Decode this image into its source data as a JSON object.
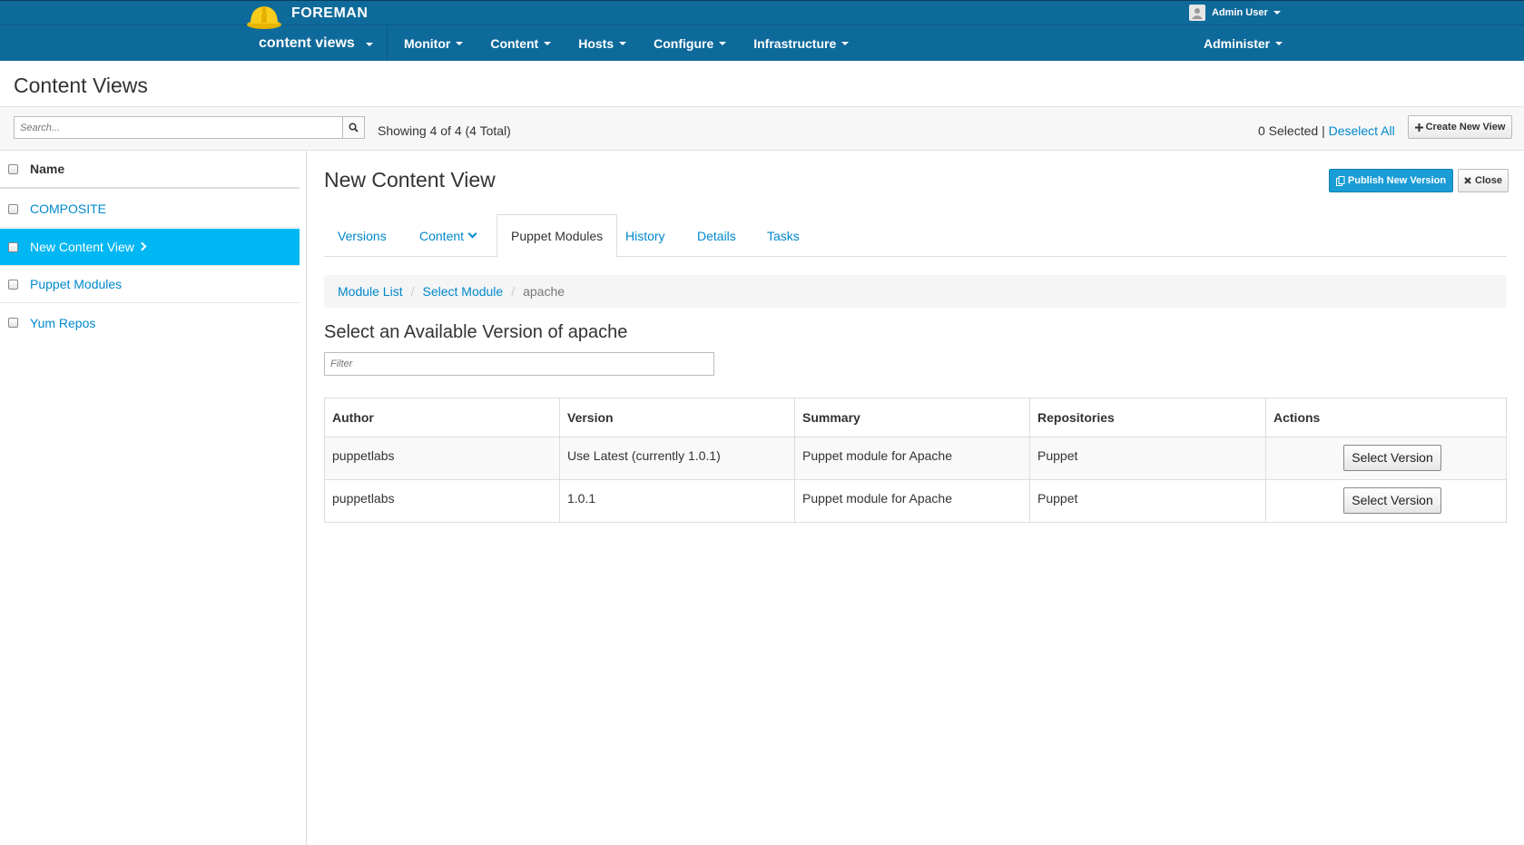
{
  "app": {
    "brand": "FOREMAN",
    "user": "Admin User",
    "context": "content views",
    "nav": [
      "Monitor",
      "Content",
      "Hosts",
      "Configure",
      "Infrastructure"
    ],
    "admin": "Administer"
  },
  "page": {
    "title": "Content Views",
    "search_placeholder": "Search...",
    "showing": "Showing 4 of 4 (4 Total)",
    "selected": "0 Selected",
    "separator": "|",
    "deselect": "Deselect All",
    "create": "Create New View"
  },
  "list": {
    "header": "Name",
    "items": [
      "COMPOSITE",
      "New Content View",
      "Puppet Modules",
      "Yum Repos"
    ]
  },
  "detail": {
    "title": "New Content View",
    "publish": "Publish New Version",
    "close": "Close",
    "tabs": [
      "Versions",
      "Content",
      "Puppet Modules",
      "History",
      "Details",
      "Tasks"
    ],
    "breadcrumb": [
      "Module List",
      "Select Module",
      "apache"
    ],
    "section_title": "Select an Available Version of apache",
    "filter_placeholder": "Filter"
  },
  "table": {
    "headers": [
      "Author",
      "Version",
      "Summary",
      "Repositories",
      "Actions"
    ],
    "rows": [
      {
        "author": "puppetlabs",
        "version": "Use Latest (currently 1.0.1)",
        "summary": "Puppet module for Apache",
        "repositories": "Puppet",
        "action": "Select Version"
      },
      {
        "author": "puppetlabs",
        "version": "1.0.1",
        "summary": "Puppet module for Apache",
        "repositories": "Puppet",
        "action": "Select Version"
      }
    ]
  },
  "colors": {
    "navbar": "#0e6a9a",
    "active_row": "#00b7f4",
    "link": "#0088cc",
    "primary_button": "#1a9cd5"
  },
  "icons": [
    "helmet-logo-icon",
    "user-avatar-icon",
    "search-icon",
    "plus-icon",
    "publish-icon",
    "close-icon",
    "chevron-right-icon",
    "chevron-down-icon"
  ]
}
